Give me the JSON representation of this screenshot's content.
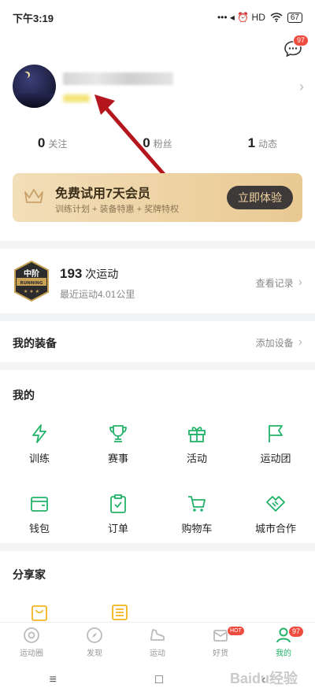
{
  "status_bar": {
    "time": "下午3:19",
    "indicators": "••• ◂ ⏰ HD",
    "battery": "67"
  },
  "header": {
    "message_badge": "97"
  },
  "stats": [
    {
      "value": "0",
      "label": "关注"
    },
    {
      "value": "0",
      "label": "粉丝"
    },
    {
      "value": "1",
      "label": "动态"
    }
  ],
  "vip": {
    "title": "免费试用7天会员",
    "subtitle": "训练计划 + 装备特惠 + 奖牌特权",
    "cta": "立即体验"
  },
  "sport": {
    "badge_top": "中阶",
    "badge_mid": "RUNNING",
    "count": "193",
    "count_suffix": "次运动",
    "recent": "最近运动4.01公里",
    "link": "查看记录"
  },
  "equipment": {
    "title": "我的装备",
    "link": "添加设备"
  },
  "mine": {
    "title": "我的",
    "items": [
      {
        "label": "训练",
        "icon": "lightning-icon"
      },
      {
        "label": "赛事",
        "icon": "trophy-icon"
      },
      {
        "label": "活动",
        "icon": "gift-icon"
      },
      {
        "label": "运动团",
        "icon": "flag-icon"
      },
      {
        "label": "钱包",
        "icon": "wallet-icon"
      },
      {
        "label": "订单",
        "icon": "clipboard-icon"
      },
      {
        "label": "购物车",
        "icon": "cart-icon"
      },
      {
        "label": "城市合作",
        "icon": "handshake-icon"
      }
    ]
  },
  "share": {
    "title": "分享家"
  },
  "tabs": [
    {
      "label": "运动圈",
      "icon": "circle-icon"
    },
    {
      "label": "发现",
      "icon": "compass-icon"
    },
    {
      "label": "运动",
      "icon": "shoe-icon"
    },
    {
      "label": "好货",
      "icon": "mail-icon",
      "badge": "HOT"
    },
    {
      "label": "我的",
      "icon": "person-icon",
      "badge": "97",
      "active": true
    }
  ],
  "nav": {
    "menu": "≡",
    "home": "□",
    "back": "‹"
  },
  "watermark": "Baidu经验",
  "colors": {
    "accent": "#23b26a",
    "badge": "#ef4b3f",
    "vip_bg": "#ecd2a5",
    "cta_bg": "#3d3a39",
    "annotation_arrow": "#b3171d"
  }
}
